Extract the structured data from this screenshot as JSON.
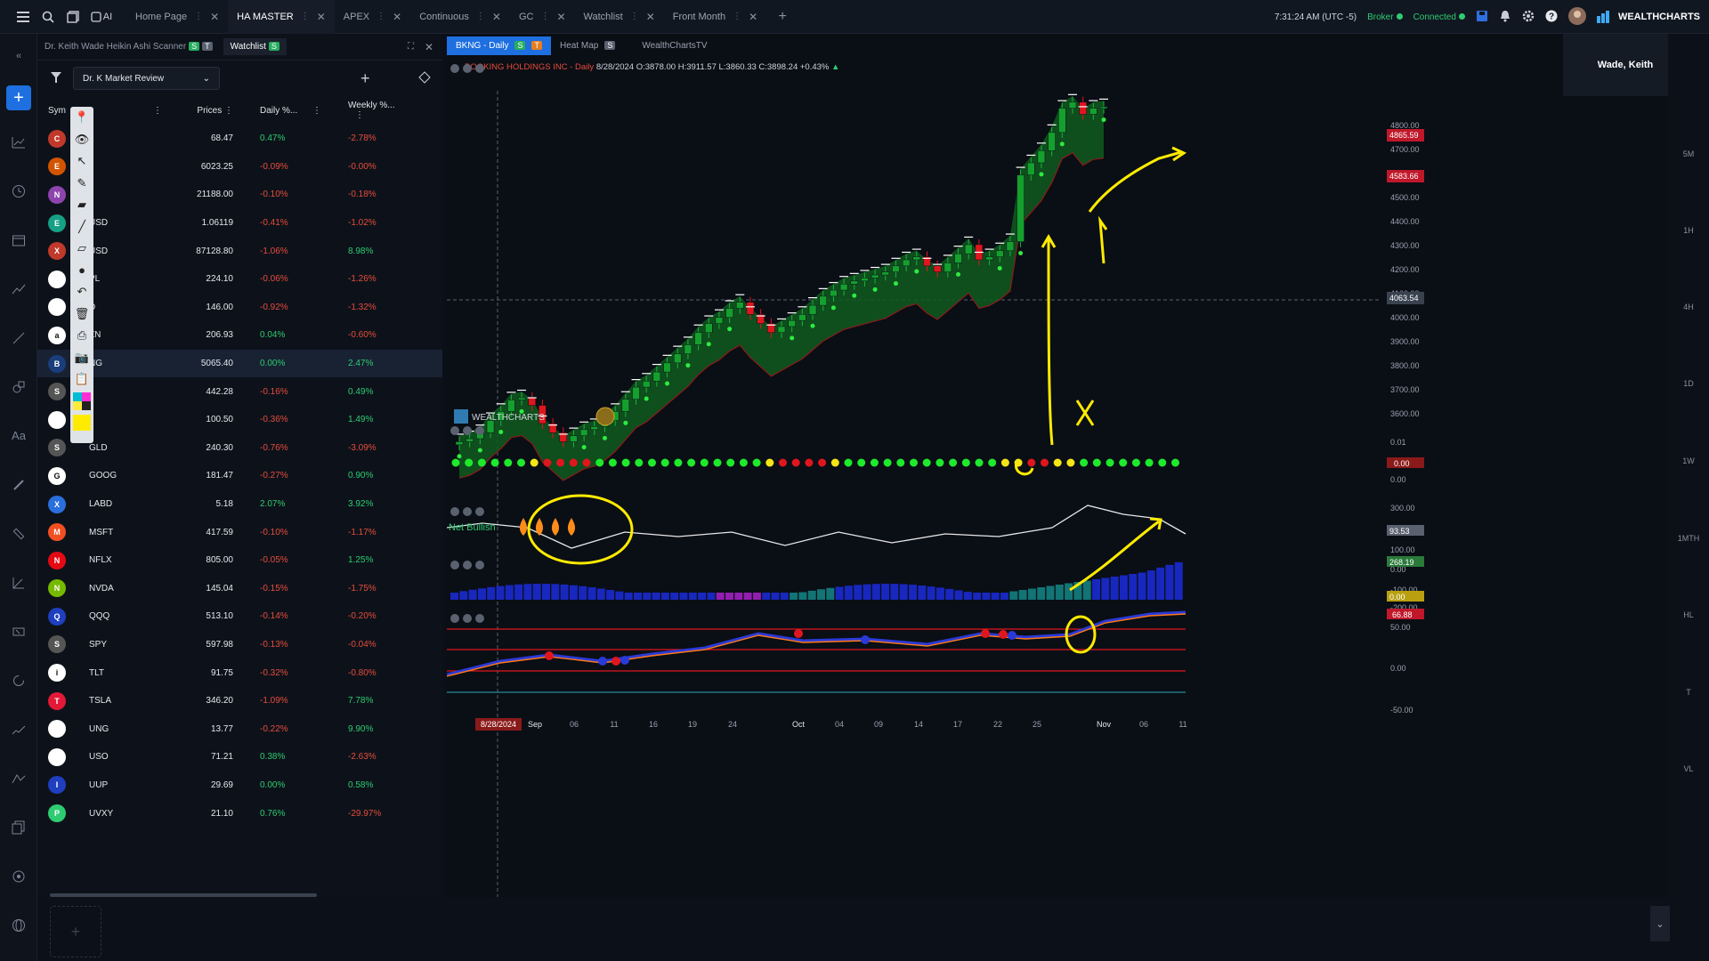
{
  "topbar": {
    "tabs": [
      {
        "label": "Home Page",
        "active": false
      },
      {
        "label": "HA MASTER",
        "active": true
      },
      {
        "label": "APEX",
        "active": false
      },
      {
        "label": "Continuous",
        "active": false
      },
      {
        "label": "GC",
        "active": false
      },
      {
        "label": "Watchlist",
        "active": false
      },
      {
        "label": "Front Month",
        "active": false
      }
    ],
    "ai_label": "AI",
    "time": "7:31:24 AM",
    "timezone": "(UTC -5)",
    "broker": "Broker",
    "connected": "Connected",
    "brand": "WEALTHCHARTS"
  },
  "panel": {
    "tabs": [
      "Dr. Keith Wade Heikin Ashi Scanner",
      "Watchlist"
    ],
    "scanner_badges": [
      "S",
      "T"
    ],
    "watchlist_badge": "S",
    "list_select": "Dr. K Market Review",
    "headers": {
      "symbol": "Sym",
      "prices": "Prices",
      "daily": "Daily %...",
      "weekly": "Weekly %..."
    },
    "rows": [
      {
        "sym": "",
        "logo": "C",
        "color": "#c0392b",
        "price": "68.47",
        "daily": "0.47%",
        "weekly": "-2.78%"
      },
      {
        "sym": "",
        "logo": "E",
        "color": "#d35400",
        "price": "6023.25",
        "daily": "-0.09%",
        "weekly": "-0.00%"
      },
      {
        "sym": "",
        "logo": "N",
        "color": "#8e44ad",
        "price": "21188.00",
        "daily": "-0.10%",
        "weekly": "-0.18%"
      },
      {
        "sym": "USD",
        "logo": "E",
        "color": "#16a085",
        "price": "1.06119",
        "daily": "-0.41%",
        "weekly": "-1.02%"
      },
      {
        "sym": "USD",
        "logo": "X",
        "color": "#c0392b",
        "price": "87128.80",
        "daily": "-1.06%",
        "weekly": "8.98%"
      },
      {
        "sym": "PL",
        "logo": "",
        "color": "#ffffff",
        "price": "224.10",
        "daily": "-0.06%",
        "weekly": "-1.26%"
      },
      {
        "sym": "D",
        "logo": "",
        "color": "#ffffff",
        "price": "146.00",
        "daily": "-0.92%",
        "weekly": "-1.32%"
      },
      {
        "sym": "ZN",
        "logo": "a",
        "color": "#ffffff",
        "price": "206.93",
        "daily": "0.04%",
        "weekly": "-0.60%"
      },
      {
        "sym": "NG",
        "logo": "B",
        "color": "#1a3d7c",
        "price": "5065.40",
        "daily": "0.00%",
        "weekly": "2.47%"
      },
      {
        "sym": "",
        "logo": "S",
        "color": "#555555",
        "price": "442.28",
        "daily": "-0.16%",
        "weekly": "0.49%"
      },
      {
        "sym": "",
        "logo": "",
        "color": "#ffffff",
        "price": "100.50",
        "daily": "-0.36%",
        "weekly": "1.49%"
      },
      {
        "sym": "GLD",
        "logo": "S",
        "color": "#555555",
        "price": "240.30",
        "daily": "-0.76%",
        "weekly": "-3.09%"
      },
      {
        "sym": "GOOG",
        "logo": "G",
        "color": "#ffffff",
        "price": "181.47",
        "daily": "-0.27%",
        "weekly": "0.90%"
      },
      {
        "sym": "LABD",
        "logo": "X",
        "color": "#2a6fdb",
        "price": "5.18",
        "daily": "2.07%",
        "weekly": "3.92%"
      },
      {
        "sym": "MSFT",
        "logo": "M",
        "color": "#f25022",
        "price": "417.59",
        "daily": "-0.10%",
        "weekly": "-1.17%"
      },
      {
        "sym": "NFLX",
        "logo": "N",
        "color": "#e50914",
        "price": "805.00",
        "daily": "-0.05%",
        "weekly": "1.25%"
      },
      {
        "sym": "NVDA",
        "logo": "N",
        "color": "#76b900",
        "price": "145.04",
        "daily": "-0.15%",
        "weekly": "-1.75%"
      },
      {
        "sym": "QQQ",
        "logo": "Q",
        "color": "#1f3fbf",
        "price": "513.10",
        "daily": "-0.14%",
        "weekly": "-0.20%"
      },
      {
        "sym": "SPY",
        "logo": "S",
        "color": "#555555",
        "price": "597.98",
        "daily": "-0.13%",
        "weekly": "-0.04%"
      },
      {
        "sym": "TLT",
        "logo": "i",
        "color": "#ffffff",
        "price": "91.75",
        "daily": "-0.32%",
        "weekly": "-0.80%"
      },
      {
        "sym": "TSLA",
        "logo": "T",
        "color": "#e31937",
        "price": "346.20",
        "daily": "-1.09%",
        "weekly": "7.78%"
      },
      {
        "sym": "UNG",
        "logo": "",
        "color": "#ffffff",
        "price": "13.77",
        "daily": "-0.22%",
        "weekly": "9.90%"
      },
      {
        "sym": "USO",
        "logo": "",
        "color": "#ffffff",
        "price": "71.21",
        "daily": "0.38%",
        "weekly": "-2.63%"
      },
      {
        "sym": "UUP",
        "logo": "I",
        "color": "#1f3fbf",
        "price": "29.69",
        "daily": "0.00%",
        "weekly": "0.58%"
      },
      {
        "sym": "UVXY",
        "logo": "P",
        "color": "#2ecc71",
        "price": "21.10",
        "daily": "0.76%",
        "weekly": "-29.97%"
      }
    ]
  },
  "chart": {
    "tabs": [
      "BKNG - Daily",
      "Heat Map",
      "WealthChartsTV"
    ],
    "tab_badges": [
      "S",
      "T"
    ],
    "heatmap_badge": "S",
    "title": "BOOKING HOLDINGS INC - Daily",
    "ohlc": "8/28/2024 O:3878.00 H:3911.57 L:3860.33 C:3898.24 +0.43%",
    "user": "Wade, Keith",
    "watermark": "WEALTHCHARTS",
    "net_bullish": "Net Bullish",
    "price_ticks": [
      "4800.00",
      "4700.00",
      "4600.00",
      "4500.00",
      "4400.00",
      "4300.00",
      "4200.00",
      "4100.00",
      "4000.00",
      "3900.00",
      "3800.00",
      "3700.00",
      "3600.00"
    ],
    "price_tags": [
      "4865.59",
      "4583.66",
      "4063.54"
    ],
    "dots_ticks": [
      "0.01",
      "0.00"
    ],
    "dots_tag": "0.00",
    "osc_ticks": [
      "300.00",
      "200.00",
      "100.00",
      "0.00",
      "-100.00",
      "-200.00"
    ],
    "osc_tags": [
      "93.53",
      "268.19",
      "0.00"
    ],
    "lower_ticks": [
      "50.00",
      "0.00",
      "-50.00"
    ],
    "lower_tag": "66.88",
    "x_ticks": [
      "Sep",
      "06",
      "11",
      "16",
      "19",
      "24",
      "Oct",
      "04",
      "09",
      "14",
      "17",
      "22",
      "25",
      "Nov",
      "06",
      "11"
    ],
    "cursor_date": "8/28/2024",
    "timeframes": [
      "5M",
      "1H",
      "4H",
      "1D",
      "1W",
      "1MTH",
      "HL",
      "T",
      "VL"
    ]
  },
  "chart_data": {
    "type": "candlestick",
    "title": "BOOKING HOLDINGS INC - Daily",
    "x_start": "2024-08-28",
    "x_end": "2024-11-11",
    "ylim": [
      3550,
      4900
    ],
    "closes": [
      3760,
      3770,
      3790,
      3830,
      3860,
      3898,
      3905,
      3880,
      3820,
      3790,
      3760,
      3780,
      3800,
      3810,
      3830,
      3860,
      3900,
      3940,
      3960,
      3990,
      4020,
      4050,
      4080,
      4120,
      4150,
      4170,
      4200,
      4220,
      4180,
      4150,
      4120,
      4140,
      4160,
      4180,
      4210,
      4240,
      4260,
      4280,
      4290,
      4300,
      4310,
      4320,
      4340,
      4360,
      4370,
      4340,
      4320,
      4350,
      4380,
      4410,
      4360,
      4370,
      4390,
      4420,
      4640,
      4680,
      4720,
      4780,
      4860,
      4880,
      4840,
      4860,
      4865
    ]
  }
}
